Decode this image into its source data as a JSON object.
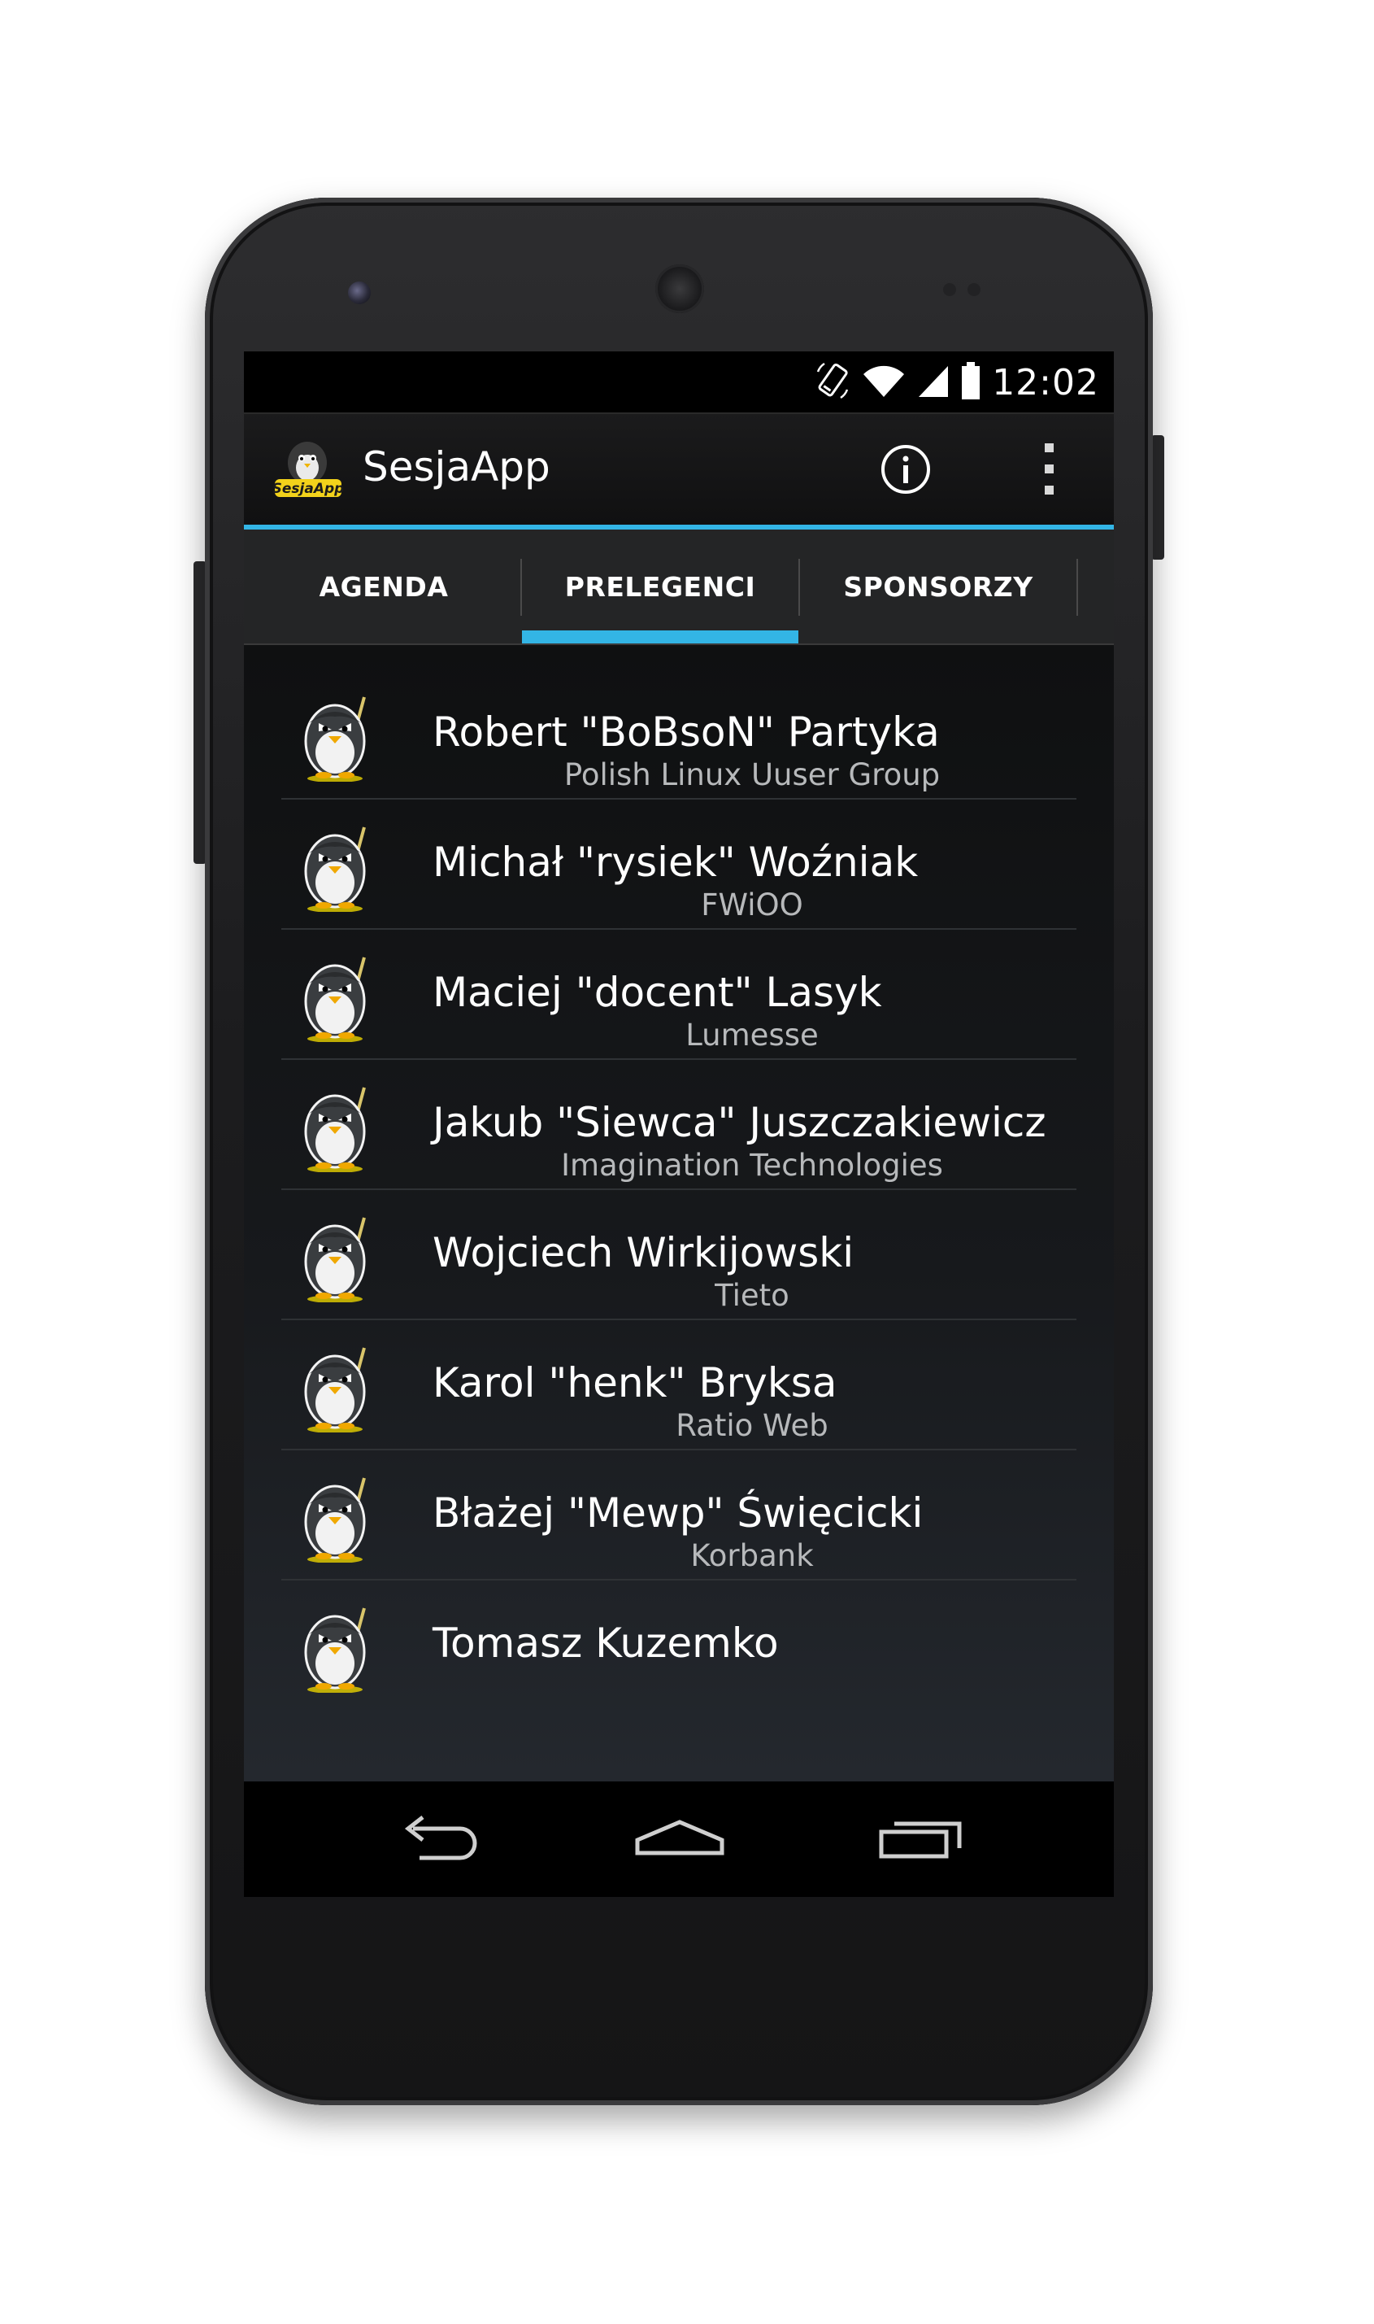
{
  "status_bar": {
    "time": "12:02",
    "icons": [
      "rotate-icon",
      "wifi-icon",
      "signal-icon",
      "battery-icon"
    ]
  },
  "action_bar": {
    "title": "SesjaApp",
    "logo_text": "SesjaApp",
    "actions": [
      "info-icon",
      "overflow-menu-icon"
    ]
  },
  "tabs": [
    {
      "label": "AGENDA",
      "selected": false
    },
    {
      "label": "PRELEGENCI",
      "selected": true
    },
    {
      "label": "SPONSORZY",
      "selected": false
    }
  ],
  "speakers": [
    {
      "name": "Robert \"BoBsoN\" Partyka",
      "company": "Polish Linux Uuser Group"
    },
    {
      "name": "Michał  \"rysiek\" Woźniak",
      "company": "FWiOO"
    },
    {
      "name": "Maciej \"docent\" Lasyk",
      "company": "Lumesse"
    },
    {
      "name": "Jakub \"Siewca\" Juszczakiewicz",
      "company": "Imagination Technologies"
    },
    {
      "name": "Wojciech Wirkijowski",
      "company": "Tieto"
    },
    {
      "name": "Karol \"henk\" Bryksa",
      "company": "Ratio Web"
    },
    {
      "name": "Błażej \"Mewp\" Święcicki",
      "company": "Korbank"
    },
    {
      "name": "Tomasz Kuzemko",
      "company": ""
    }
  ],
  "nav_bar": [
    "back-icon",
    "home-icon",
    "recent-apps-icon"
  ],
  "colors": {
    "accent": "#33b5e5",
    "background": "#000000",
    "text_primary": "#ffffff",
    "text_secondary": "#b7b9bb"
  }
}
